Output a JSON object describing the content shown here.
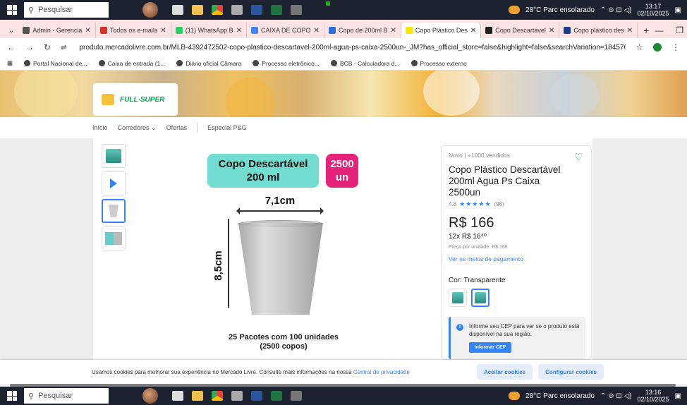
{
  "taskbar": {
    "search_label": "Pesquisar",
    "weather": "28°C  Parc ensolarado",
    "time_top": "13:17",
    "date_top": "02/10/2025",
    "time_bottom": "13:16",
    "date_bottom": "02/10/2025"
  },
  "tabs": [
    {
      "label": "Admin - Gerencia",
      "color": "#555555"
    },
    {
      "label": "Todos os e-mails",
      "color": "#d93025"
    },
    {
      "label": "(11) WhatsApp B",
      "color": "#25d366"
    },
    {
      "label": "CAIXA DE COPO",
      "color": "#4285f4"
    },
    {
      "label": "Copo de 200ml B",
      "color": "#2a6fdb"
    },
    {
      "label": "Copo Plástico Des",
      "color": "#ffe600"
    },
    {
      "label": "Copo Descartável",
      "color": "#222222"
    },
    {
      "label": "Copo plástico des",
      "color": "#1a3c8a"
    }
  ],
  "addressbar": {
    "url": "produto.mercadolivre.com.br/MLB-4392472502-copo-plastico-descartavel-200ml-agua-ps-caixa-2500un-_JM?has_official_store=false&highlight=false&searchVariation=184576017199&headerTopBrand=false#p..."
  },
  "bookmarks": [
    "Portal Nacional de...",
    "Caixa de entrada (1...",
    "Diário oficial Câmara",
    "Processo eletrônico...",
    "BCB - Calculadora d...",
    "Processo externo"
  ],
  "store": {
    "brand": "FULL·SUPER"
  },
  "subnav": [
    "Início",
    "Corredores ⌄",
    "Ofertas",
    "Especial P&G"
  ],
  "product_image": {
    "name_line1": "Copo Descartável",
    "name_line2": "200 ml",
    "qty_line1": "2500",
    "qty_line2": "un",
    "width_label": "7,1cm",
    "height_label": "8,5cm",
    "caption_line1": "25 Pacotes com 100 unidades",
    "caption_line2": "(2500 copos)"
  },
  "buybox": {
    "condition": "Novo  |  +1000 vendidos",
    "title": "Copo Plástico Descartável 200ml Agua Ps Caixa 2500un",
    "rating_value": "4.8",
    "stars": "★★★★★",
    "reviews": "(96)",
    "price": "R$ 166",
    "installments": "12x R$ 16⁴⁰",
    "unit_price": "Preço por unidade: R$ 166",
    "payment_link": "Ver os meios de pagamento",
    "color_label": "Cor:",
    "color_value": "Transparente",
    "cep_text": "Informe seu CEP para ver se o produto está disponível na sua região.",
    "cep_button": "Informar CEP"
  },
  "cookie": {
    "text": "Usamos cookies para melhorar sua experiência no Mercado Livre. Consulte mais informações na nossa ",
    "link": "Central de privacidade",
    "accept": "Aceitar cookies",
    "configure": "Configurar cookies"
  }
}
